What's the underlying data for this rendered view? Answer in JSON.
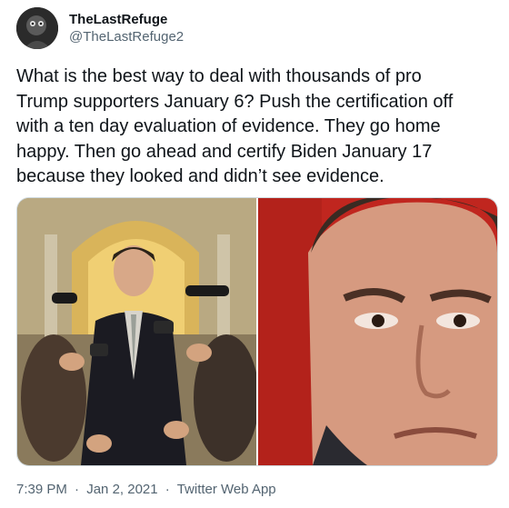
{
  "author": {
    "display_name": "TheLastRefuge",
    "handle": "@TheLastRefuge2"
  },
  "tweet": {
    "text": "What is the best way to deal with thousands of pro\nTrump supporters January 6? Push the certification off\nwith a ten day evaluation of evidence. They go home\nhappy. Then go ahead and certify Biden January 17\nbecause they looked and didn’t see evidence.",
    "time": "7:39 PM",
    "separator": "·",
    "date": "Jan 2, 2021",
    "source": "Twitter Web App"
  },
  "media": [
    {
      "name": "photo-press-scrum",
      "description_icon": "photo-icon"
    },
    {
      "name": "photo-face-closeup",
      "description_icon": "photo-icon"
    }
  ],
  "colors": {
    "text": "#0f1419",
    "secondary": "#536471",
    "border": "#cfd9de"
  }
}
